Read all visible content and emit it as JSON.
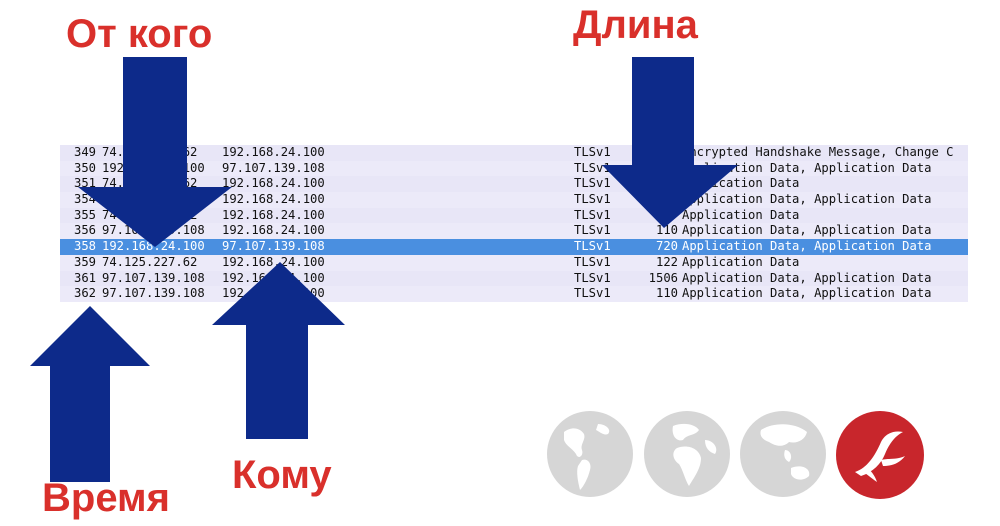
{
  "annotations": {
    "from": "От кого",
    "length": "Длина",
    "time": "Время",
    "to": "Кому"
  },
  "packets": [
    {
      "no": "349",
      "src": "74.125.227.62",
      "dst": "192.168.24.100",
      "proto": "TLSv1",
      "len": "",
      "info": "Encrypted Handshake Message, Change C"
    },
    {
      "no": "350",
      "src": "192.168.24.100",
      "dst": "97.107.139.108",
      "proto": "TLSv1",
      "len": "",
      "info": "Application Data, Application Data"
    },
    {
      "no": "351",
      "src": "74.125.227.62",
      "dst": "192.168.24.100",
      "proto": "TLSv1",
      "len": "",
      "info": "Application Data"
    },
    {
      "no": "354",
      "src": "97.107.139.108",
      "dst": "192.168.24.100",
      "proto": "TLSv1",
      "len": "",
      "info": "Application Data, Application Data"
    },
    {
      "no": "355",
      "src": "74.125.227.62",
      "dst": "192.168.24.100",
      "proto": "TLSv1",
      "len": "",
      "info": "Application Data"
    },
    {
      "no": "356",
      "src": "97.107.139.108",
      "dst": "192.168.24.100",
      "proto": "TLSv1",
      "len": "110",
      "info": "Application Data, Application Data"
    },
    {
      "no": "358",
      "src": "192.168.24.100",
      "dst": "97.107.139.108",
      "proto": "TLSv1",
      "len": "720",
      "info": "Application Data, Application Data",
      "selected": true
    },
    {
      "no": "359",
      "src": "74.125.227.62",
      "dst": "192.168.24.100",
      "proto": "TLSv1",
      "len": "122",
      "info": "Application Data"
    },
    {
      "no": "361",
      "src": "97.107.139.108",
      "dst": "192.168.24.100",
      "proto": "TLSv1",
      "len": "1506",
      "info": "Application Data, Application Data"
    },
    {
      "no": "362",
      "src": "97.107.139.108",
      "dst": "192.168.24.100",
      "proto": "TLSv1",
      "len": "110",
      "info": "Application Data, Application Data"
    }
  ],
  "colors": {
    "label_red": "#d9302b",
    "arrow_navy": "#0d2a8a",
    "row_bg": "#e8e6f7",
    "selected_row_bg": "#4a8fe0",
    "globe_gray": "#d6d6d6",
    "logo_red": "#c8262c"
  },
  "icons": [
    "globe-americas-icon",
    "globe-europe-africa-icon",
    "globe-asia-australia-icon",
    "brand-logo-icon"
  ]
}
